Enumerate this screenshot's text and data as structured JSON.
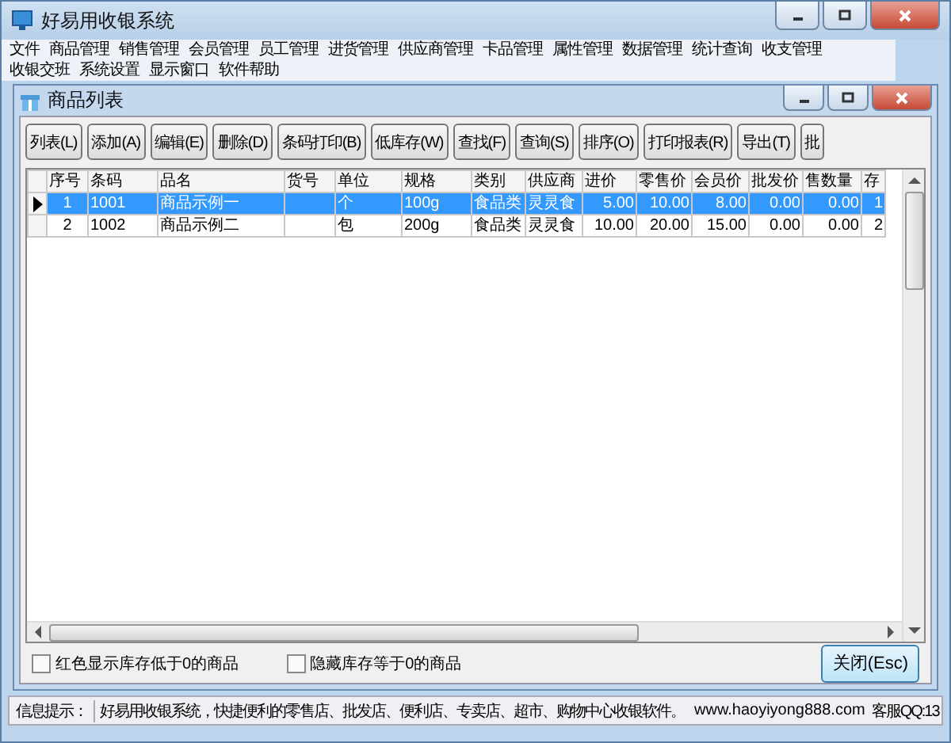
{
  "window": {
    "title": "好易用收银系统"
  },
  "menu": [
    "文件",
    "商品管理",
    "销售管理",
    "会员管理",
    "员工管理",
    "进货管理",
    "供应商管理",
    "卡品管理",
    "属性管理",
    "数据管理",
    "统计查询",
    "收支管理",
    "收银交班",
    "系统设置",
    "显示窗口",
    "软件帮助"
  ],
  "child_window": {
    "title": "商品列表"
  },
  "toolbar": [
    "列表(L)",
    "添加(A)",
    "编辑(E)",
    "删除(D)",
    "条码打印(B)",
    "低库存(W)",
    "查找(F)",
    "查询(S)",
    "排序(O)",
    "打印报表(R)",
    "导出(T)",
    "批"
  ],
  "table": {
    "columns": [
      "序号",
      "条码",
      "品名",
      "货号",
      "单位",
      "规格",
      "类别",
      "供应商",
      "进价",
      "零售价",
      "会员价",
      "批发价",
      "售数量",
      "存"
    ],
    "rows": [
      {
        "selected": true,
        "cells": [
          "1",
          "1001",
          "商品示例一",
          "",
          "个",
          "100g",
          "食品类",
          "灵灵食",
          "5.00",
          "10.00",
          "8.00",
          "0.00",
          "0.00",
          "1"
        ]
      },
      {
        "selected": false,
        "cells": [
          "2",
          "1002",
          "商品示例二",
          "",
          "包",
          "200g",
          "食品类",
          "灵灵食",
          "10.00",
          "20.00",
          "15.00",
          "0.00",
          "0.00",
          "2"
        ]
      }
    ]
  },
  "options": [
    {
      "label": "红色显示库存低于0的商品",
      "checked": false
    },
    {
      "label": "隐藏库存等于0的商品",
      "checked": false
    }
  ],
  "close_button": "关闭(Esc)",
  "status_bar": {
    "label": "信息提示：",
    "message": "好易用收银系统，快捷便利的零售店、批发店、便利店、专卖店、超市、购物中心收银软件。",
    "website": "www.haoyiyong888.com",
    "support": "客服QQ:13"
  }
}
